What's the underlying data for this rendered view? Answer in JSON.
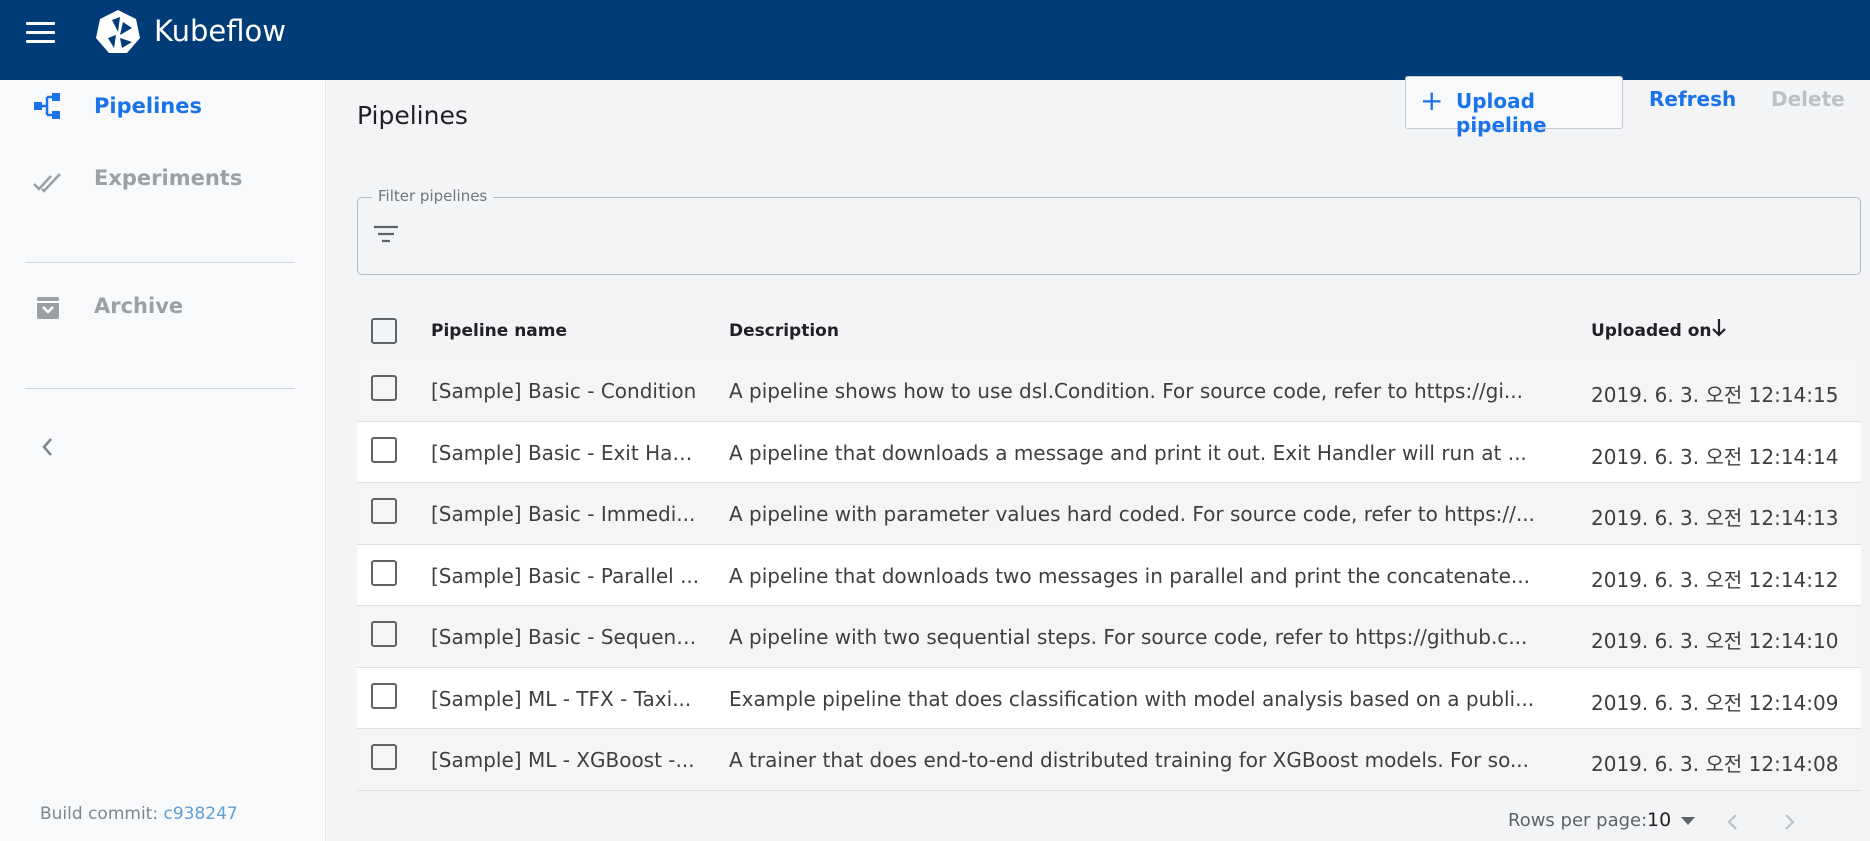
{
  "app": {
    "title": "Kubeflow"
  },
  "sidebar": {
    "items": [
      {
        "label": "Pipelines",
        "icon": "pipelines-icon",
        "active": true
      },
      {
        "label": "Experiments",
        "icon": "experiments-icon",
        "active": false
      },
      {
        "label": "Archive",
        "icon": "archive-icon",
        "active": false
      }
    ],
    "build_label": "Build commit:",
    "build_commit": "c938247"
  },
  "page": {
    "title": "Pipelines"
  },
  "toolbar": {
    "upload_label": "Upload pipeline",
    "refresh_label": "Refresh",
    "delete_label": "Delete"
  },
  "filter": {
    "label": "Filter pipelines",
    "value": ""
  },
  "table": {
    "columns": [
      "Pipeline name",
      "Description",
      "Uploaded on"
    ],
    "rows": [
      {
        "name": "[Sample] Basic - Condition",
        "description": "A pipeline shows how to use dsl.Condition. For source code, refer to https://gi...",
        "uploaded": "2019. 6. 3. 오전 12:14:15"
      },
      {
        "name": "[Sample] Basic - Exit Han...",
        "description": "A pipeline that downloads a message and print it out. Exit Handler will run at ...",
        "uploaded": "2019. 6. 3. 오전 12:14:14"
      },
      {
        "name": "[Sample] Basic - Immedi...",
        "description": "A pipeline with parameter values hard coded. For source code, refer to https://...",
        "uploaded": "2019. 6. 3. 오전 12:14:13"
      },
      {
        "name": "[Sample] Basic - Parallel ...",
        "description": "A pipeline that downloads two messages in parallel and print the concatenate...",
        "uploaded": "2019. 6. 3. 오전 12:14:12"
      },
      {
        "name": "[Sample] Basic - Sequent...",
        "description": "A pipeline with two sequential steps. For source code, refer to https://github.c...",
        "uploaded": "2019. 6. 3. 오전 12:14:10"
      },
      {
        "name": "[Sample] ML - TFX - Taxi...",
        "description": "Example pipeline that does classification with model analysis based on a publi...",
        "uploaded": "2019. 6. 3. 오전 12:14:09"
      },
      {
        "name": "[Sample] ML - XGBoost -...",
        "description": "A trainer that does end-to-end distributed training for XGBoost models. For so...",
        "uploaded": "2019. 6. 3. 오전 12:14:08"
      }
    ]
  },
  "pagination": {
    "rows_per_page_label": "Rows per page:",
    "rows_per_page": "10"
  },
  "colors": {
    "topbar": "#003c78",
    "accent": "#1a73e8",
    "muted": "#9aa0a6"
  }
}
